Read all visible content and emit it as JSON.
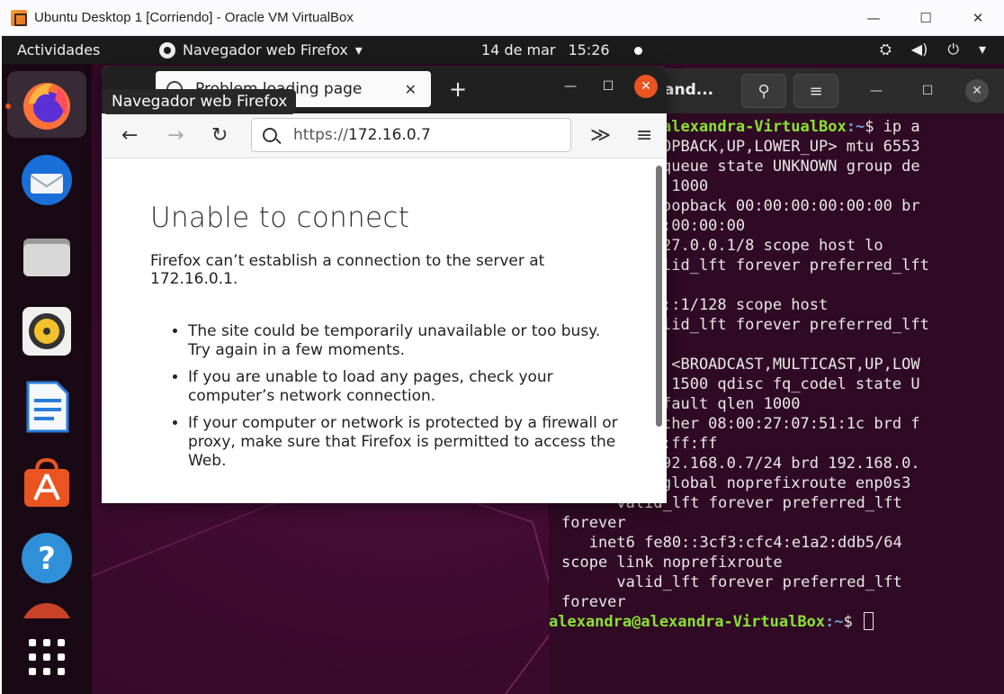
{
  "vbox": {
    "title": "Ubuntu Desktop 1 [Corriendo] - Oracle VM VirtualBox",
    "minimize": "—",
    "maximize": "☐",
    "close": "✕"
  },
  "topbar": {
    "activities": "Actividades",
    "app_menu": "Navegador web Firefox",
    "app_menu_arrow": "▾",
    "date": "14 de mar",
    "time": "15:26",
    "tray_icons": [
      "network-icon",
      "volume-icon",
      "power-icon",
      "menu-arrow-icon"
    ],
    "tray_glyphs": [
      "⛭",
      "◀)",
      "⏻",
      "▾"
    ]
  },
  "dock": {
    "items": [
      {
        "name": "firefox",
        "icon": "firefox-icon",
        "running": true
      },
      {
        "name": "thunderbird",
        "icon": "thunderbird-icon",
        "running": false
      },
      {
        "name": "files",
        "icon": "files-icon",
        "running": false
      },
      {
        "name": "rhythmbox",
        "icon": "rhythmbox-icon",
        "running": false
      },
      {
        "name": "libreoffice-writer",
        "icon": "writer-icon",
        "running": false
      },
      {
        "name": "ubuntu-software",
        "icon": "software-icon",
        "running": false
      },
      {
        "name": "help",
        "icon": "help-icon",
        "running": false
      },
      {
        "name": "partial-app",
        "icon": "app-icon",
        "running": false
      }
    ],
    "show_apps_icon": "grid-icon"
  },
  "tooltip": "Navegador web Firefox",
  "firefox": {
    "tab_title": "Problem loading page",
    "tab_close": "✕",
    "new_tab": "+",
    "url_scheme": "https://",
    "url_host": "172.16.0.7",
    "overflow_glyph": "≫",
    "menu_glyph": "≡",
    "back_glyph": "←",
    "forward_glyph": "→",
    "reload_glyph": "↻",
    "win_min": "—",
    "win_max": "☐",
    "win_close": "✕",
    "error_title": "Unable to connect",
    "error_desc": "Firefox can’t establish a connection to the server at 172.16.0.1.",
    "bullets": [
      "The site could be temporarily unavailable or too busy. Try again in a few moments.",
      "If you are unable to load any pages, check your computer’s network connection.",
      "If your computer or network is protected by a firewall or proxy, make sure that Firefox is permitted to access the Web."
    ]
  },
  "terminal": {
    "title": "and...",
    "search_glyph": "⚲",
    "menu_glyph": "≡",
    "min": "—",
    "max": "☐",
    "close": "✕",
    "lines": [
      "alexandra-VirtualBox:~$ ip a",
      "OPBACK,UP,LOWER_UP> mtu 6553",
      "queue state UNKNOWN group de",
      " 1000",
      "oopback 00:00:00:00:00:00 br",
      ":00:00:00",
      "27.0.0.1/8 scope host lo",
      "lid_lft forever preferred_lft",
      "",
      "::1/128 scope host",
      "lid_lft forever preferred_lft",
      "",
      " <BROADCAST,MULTICAST,UP,LOW",
      " 1500 qdisc fq_codel state U",
      "fault qlen 1000",
      "ther 08:00:27:07:51:1c brd f",
      ":ff:ff",
      "92.168.0.7/24 brd 192.168.0.",
      "global noprefixroute enp0s3",
      "      valid_lft forever preferred_lft",
      "forever",
      "   inet6 fe80::3cf3:cfc4:e1a2:ddb5/64",
      "scope link noprefixroute",
      "      valid_lft forever preferred_lft",
      "forever"
    ],
    "prompt_user": "alexandra@alexandra-VirtualBox",
    "prompt_path": ":~",
    "prompt_symbol": "$ "
  }
}
